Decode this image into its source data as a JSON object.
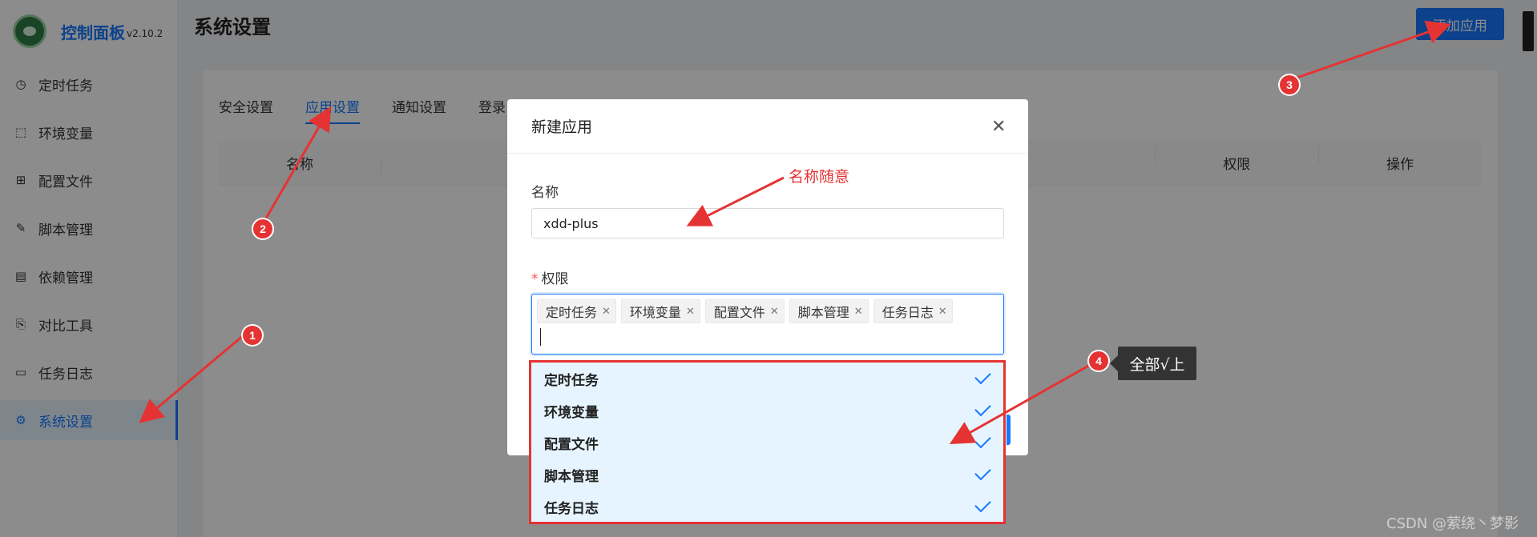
{
  "app": {
    "title": "控制面板",
    "version": "v2.10.2"
  },
  "sidebar": {
    "items": [
      {
        "label": "定时任务",
        "icon": "clock-icon"
      },
      {
        "label": "环境变量",
        "icon": "variable-icon"
      },
      {
        "label": "配置文件",
        "icon": "config-icon"
      },
      {
        "label": "脚本管理",
        "icon": "edit-icon"
      },
      {
        "label": "依赖管理",
        "icon": "package-icon"
      },
      {
        "label": "对比工具",
        "icon": "diff-icon"
      },
      {
        "label": "任务日志",
        "icon": "folder-icon"
      },
      {
        "label": "系统设置",
        "icon": "gear-icon",
        "active": true
      }
    ]
  },
  "header": {
    "title": "系统设置",
    "add_button": "添加应用"
  },
  "tabs": [
    {
      "label": "安全设置"
    },
    {
      "label": "应用设置",
      "active": true
    },
    {
      "label": "通知设置"
    },
    {
      "label": "登录"
    }
  ],
  "table": {
    "columns": [
      "名称",
      "权限",
      "操作"
    ]
  },
  "modal": {
    "title": "新建应用",
    "name_label": "名称",
    "name_value": "xdd-plus",
    "perm_label": "权限",
    "required_mark": "*",
    "selected_tags": [
      "定时任务",
      "环境变量",
      "配置文件",
      "脚本管理",
      "任务日志"
    ],
    "options": [
      "定时任务",
      "环境变量",
      "配置文件",
      "脚本管理",
      "任务日志"
    ]
  },
  "annotations": {
    "name_note": "名称随意",
    "tooltip": "全部√上",
    "badges": [
      "1",
      "2",
      "3",
      "4"
    ],
    "watermark": "CSDN @萦绕丶梦影"
  },
  "colors": {
    "accent": "#1677ff",
    "annotation": "#e53333"
  }
}
